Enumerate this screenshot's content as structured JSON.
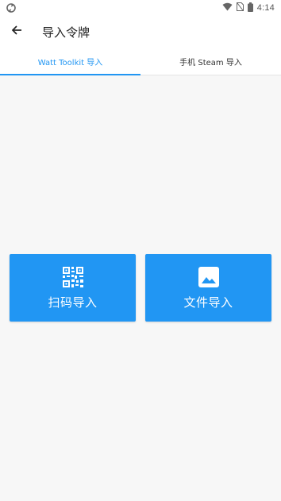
{
  "status_bar": {
    "time": "4:14",
    "icons": [
      "sync-icon",
      "wifi-icon",
      "no-sim-icon",
      "battery-icon"
    ]
  },
  "app_bar": {
    "title": "导入令牌",
    "back_icon": "arrow-left-icon"
  },
  "tabs": [
    {
      "label": "Watt Toolkit 导入",
      "active": true
    },
    {
      "label": "手机 Steam 导入",
      "active": false
    }
  ],
  "actions": [
    {
      "label": "扫码导入",
      "icon": "qr-code-icon"
    },
    {
      "label": "文件导入",
      "icon": "image-icon"
    }
  ],
  "colors": {
    "accent": "#2196f3",
    "background": "#f7f7f7",
    "appbar": "#ffffff"
  }
}
